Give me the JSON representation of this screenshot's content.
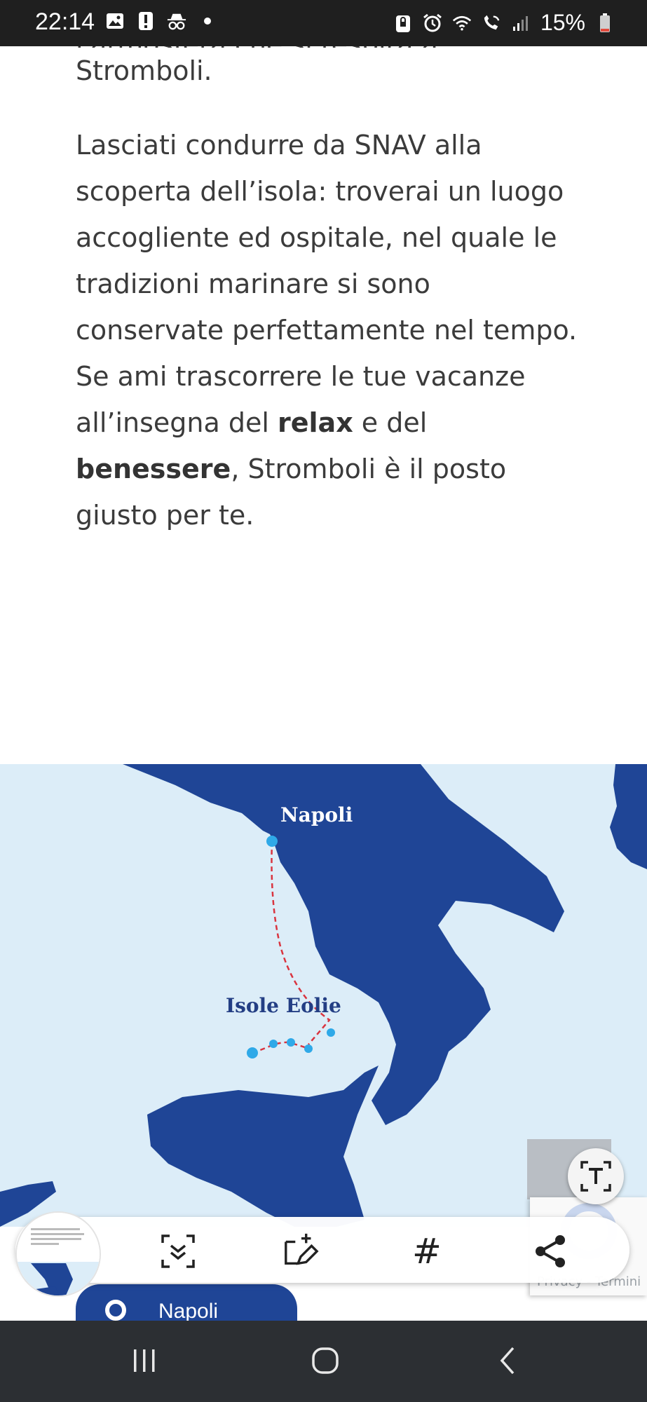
{
  "status_bar": {
    "time": "22:14",
    "battery": "15%",
    "left_icons": [
      "gallery-icon",
      "alert-icon",
      "incognito-icon",
      "dot-icon"
    ],
    "right_icons": [
      "lock-icon",
      "alarm-icon",
      "wifi-icon",
      "wifi-call-icon",
      "signal-icon",
      "battery-icon"
    ]
  },
  "article": {
    "cut_line": "l'atmosfera che si respira a",
    "para1": "Stromboli.",
    "para2_a": "Lasciati condurre da SNAV alla scoperta dell’isola: troverai un luogo accogliente ed ospitale, nel quale le tradizioni marinare si sono conservate perfettamente nel tempo. Se ami trascorrere le tue vacanze all’insegna del ",
    "para2_b1": "relax",
    "para2_c": " e del ",
    "para2_b2": "benessere",
    "para2_d": ", Stromboli è il posto giusto per te."
  },
  "map": {
    "label_napoli": "Napoli",
    "label_eolie": "Isole Eolie",
    "land_color": "#1f4596",
    "sea_color": "#dcedf8",
    "route_color": "#d9343f",
    "port_color": "#2fa9e8"
  },
  "recaptcha": {
    "text": "Privacy - Termini"
  },
  "toolbar": {
    "hash_label": "#",
    "items": [
      "scroll-capture-icon",
      "draw-edit-icon",
      "hashtag-icon",
      "share-icon"
    ]
  },
  "pill_button": {
    "label": "Napoli"
  },
  "nav_bar": {
    "items": [
      "recents-icon",
      "home-icon",
      "back-icon"
    ]
  }
}
